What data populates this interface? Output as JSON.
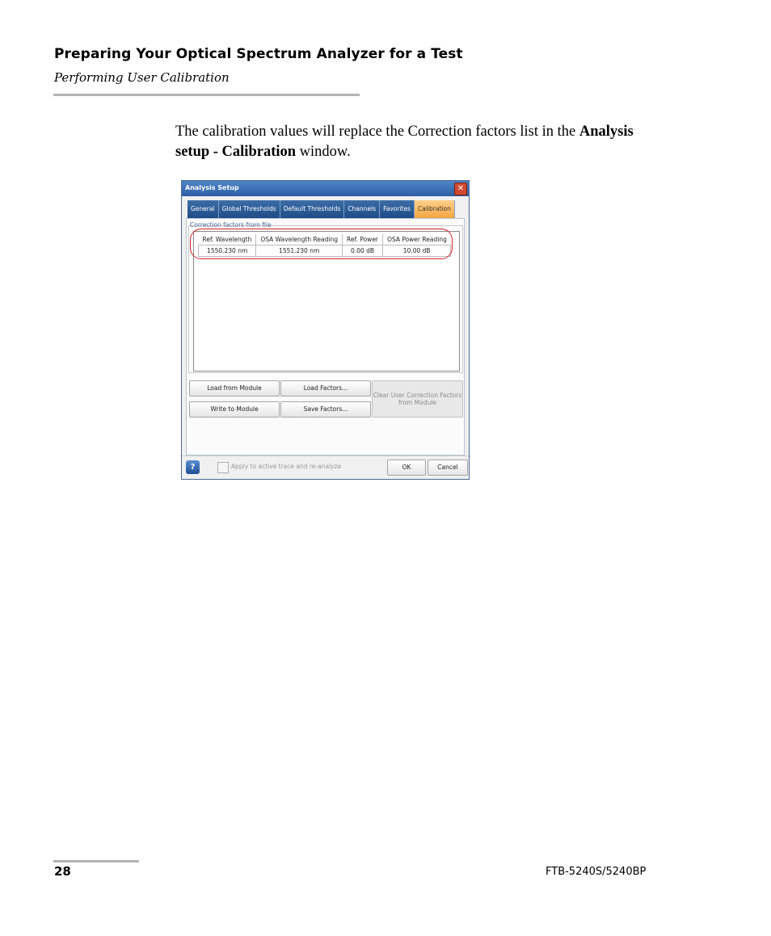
{
  "header": {
    "title": "Preparing Your Optical Spectrum Analyzer for a Test",
    "subtitle": "Performing User Calibration"
  },
  "body": {
    "text_before": "The calibration values will replace the Correction factors list in the ",
    "bold": "Analysis setup - Calibration",
    "text_after": " window."
  },
  "dialog": {
    "title": "Analysis Setup",
    "close_glyph": "✕",
    "tabs": [
      "General",
      "Global Thresholds",
      "Default Thresholds",
      "Channels",
      "Favorites",
      "Calibration"
    ],
    "active_tab": "Calibration",
    "group_label": "Correction factors from file",
    "table": {
      "headers": [
        "Ref. Wavelength",
        "OSA Wavelength Reading",
        "Ref. Power",
        "OSA Power Reading"
      ],
      "rows": [
        [
          "1550.230 nm",
          "1551.230 nm",
          "0.00 dB",
          "10.00 dB"
        ]
      ]
    },
    "buttons": {
      "load_from_module": "Load from Module",
      "load_factors": "Load Factors...",
      "write_to_module": "Write to Module",
      "save_factors": "Save Factors...",
      "clear_line1": "Clear User Correction Factors",
      "clear_line2": "from Module",
      "ok": "OK",
      "cancel": "Cancel"
    },
    "help_glyph": "?",
    "apply_label": "Apply to active trace and re-analyze",
    "colors": {
      "active_tab": "#f4a640",
      "tab": "#2d5ea3",
      "callout": "#d2242c"
    }
  },
  "footer": {
    "page_number": "28",
    "model": "FTB-5240S/5240BP"
  }
}
